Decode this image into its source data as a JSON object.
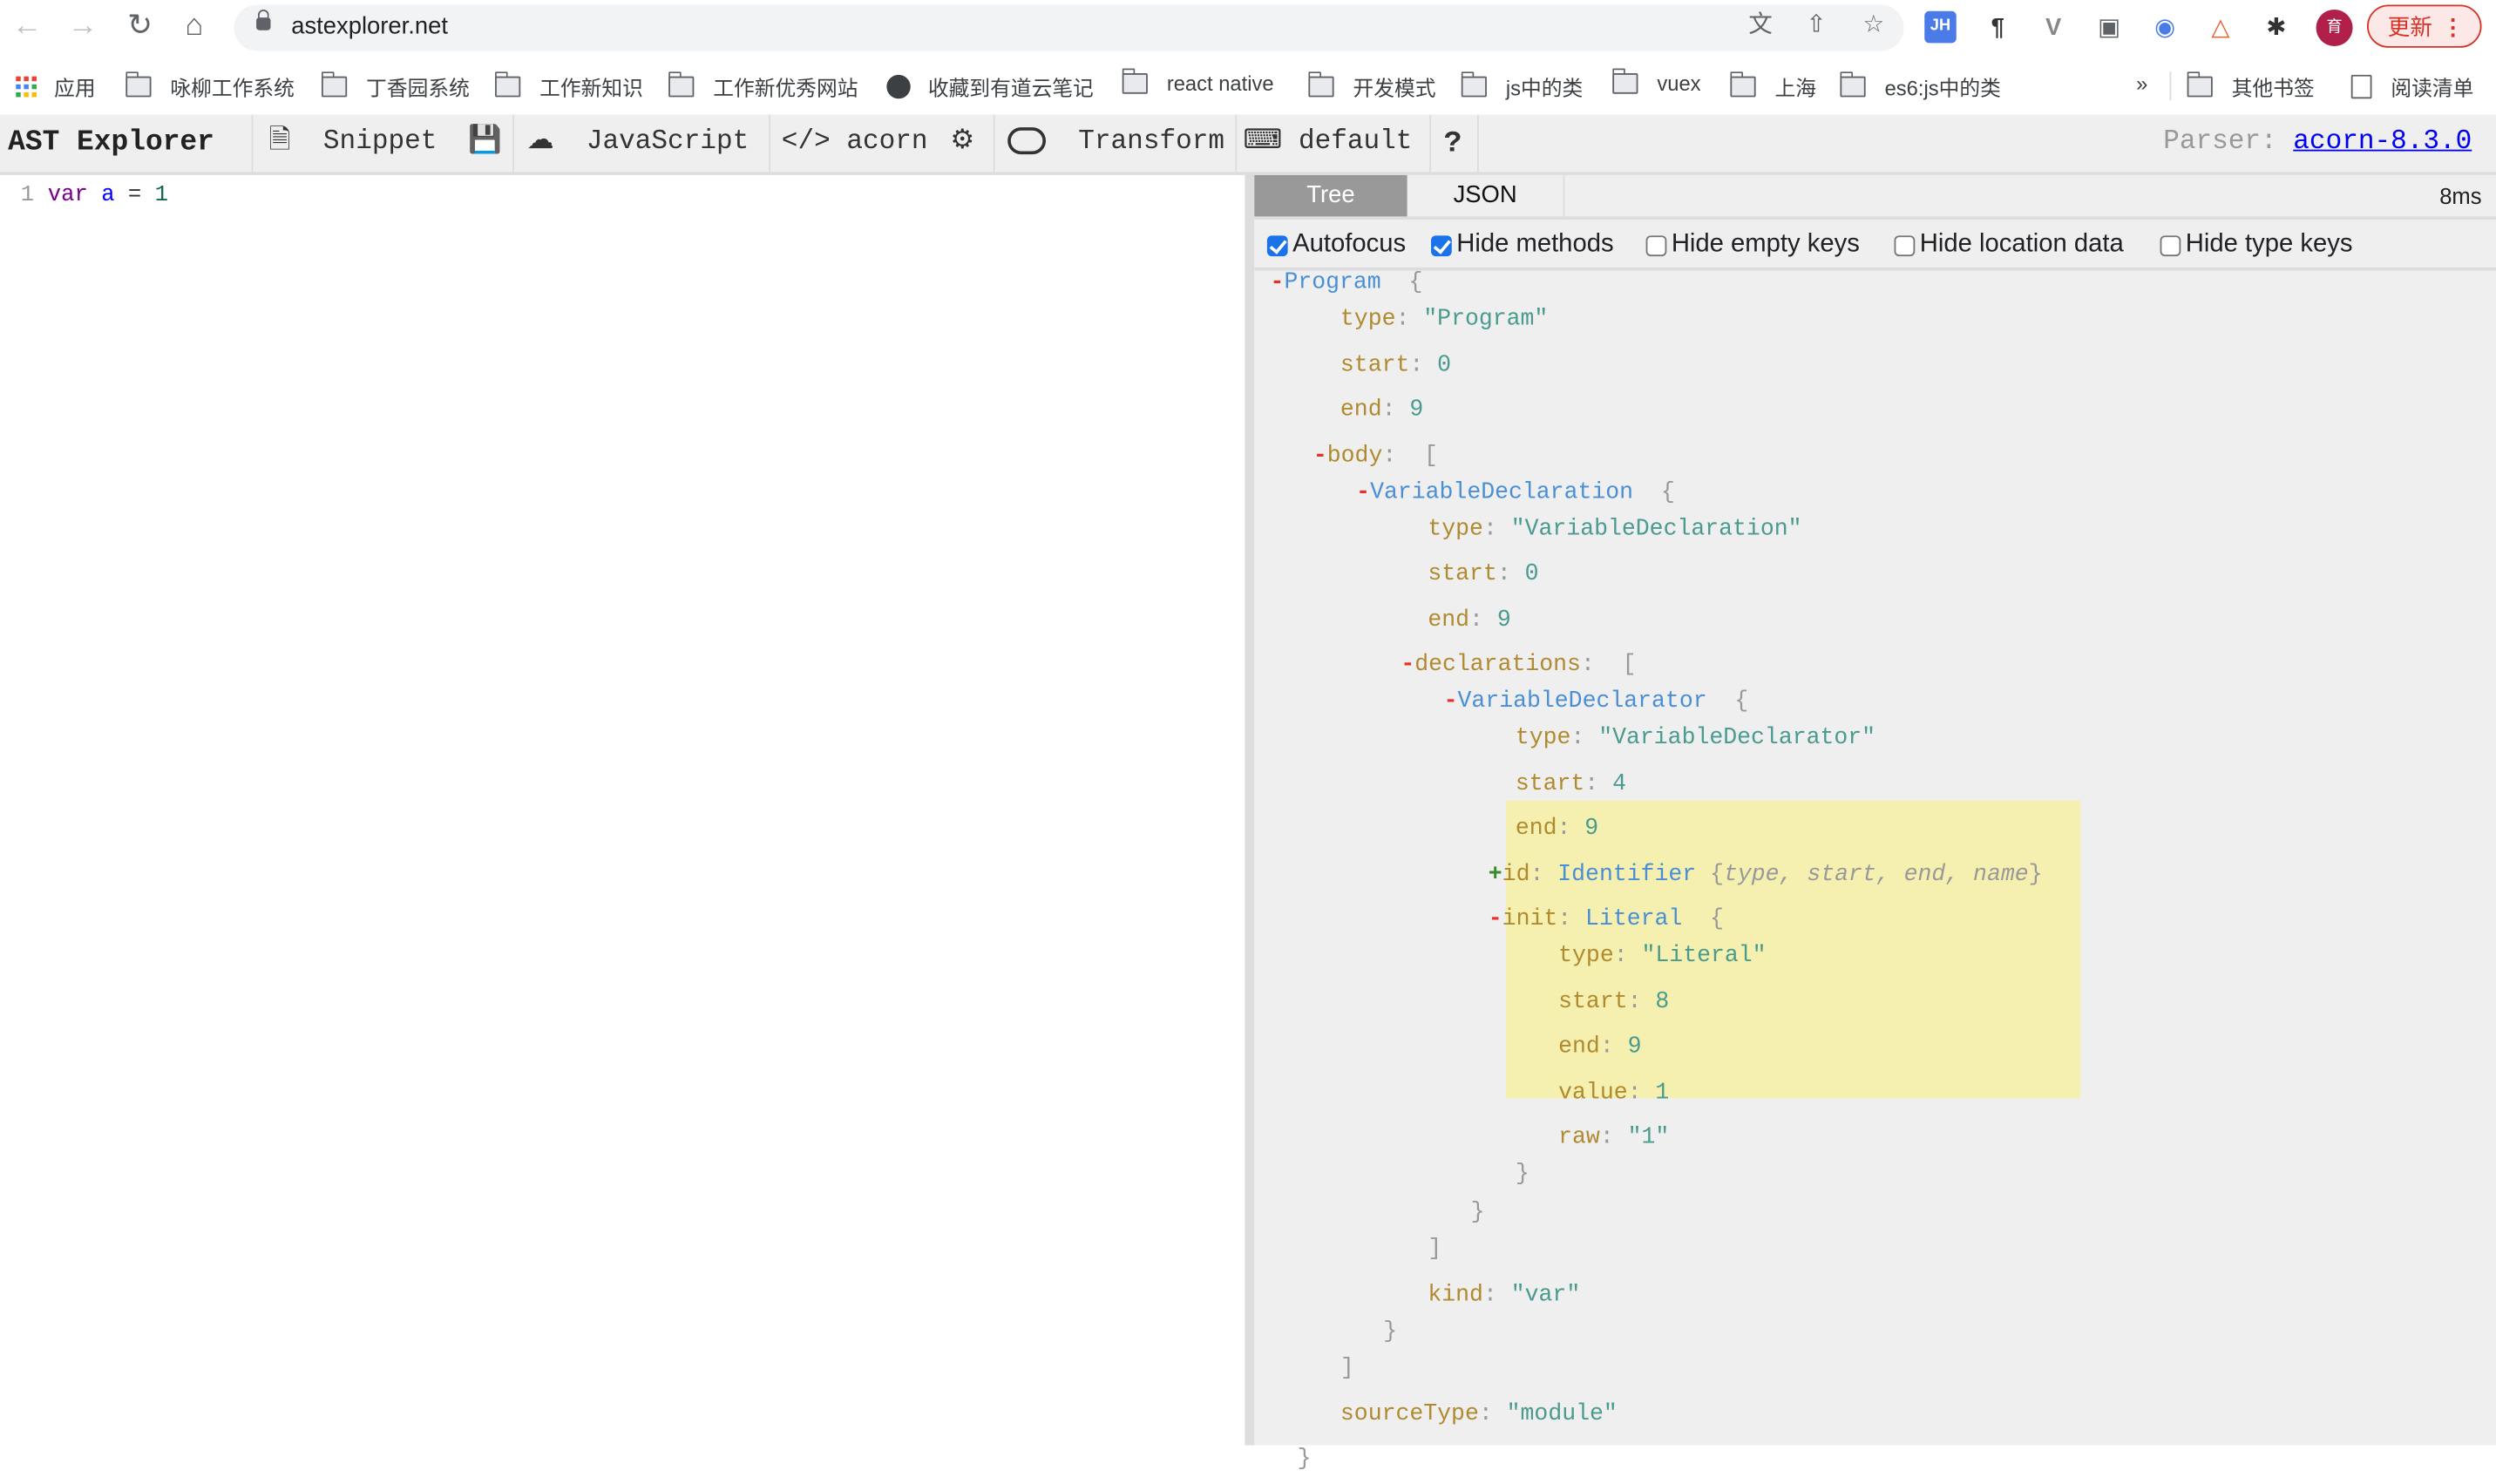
{
  "browser": {
    "url": "astexplorer.net",
    "update_label": "更新",
    "profile_initial": "育",
    "extensions": [
      "translate-icon",
      "share-icon",
      "star-icon",
      "jh-extension-icon",
      "pilcrow-extension-icon",
      "vue-devtools-icon",
      "extension-icon",
      "extension-icon",
      "extension-icon",
      "puzzle-icon"
    ]
  },
  "bookmarks": {
    "apps": "应用",
    "items": [
      "咏柳工作系统",
      "丁香园系统",
      "工作新知识",
      "工作新优秀网站",
      "收藏到有道云笔记",
      "react native",
      "开发模式",
      "js中的类",
      "vuex",
      "上海",
      "es6:js中的类"
    ],
    "more": "»",
    "other": "其他书签",
    "reading_list": "阅读清单"
  },
  "toolbar": {
    "brand": "AST Explorer",
    "snippet": "Snippet",
    "language": "JavaScript",
    "parser": "acorn",
    "transform": "Transform",
    "keymap": "default",
    "help": "?",
    "parser_label": "Parser:",
    "parser_version": "acorn-8.3.0"
  },
  "editor": {
    "line_number": "1",
    "code": {
      "kw": "var",
      "name": "a",
      "op": "=",
      "num": "1"
    }
  },
  "panel": {
    "tabs": [
      "Tree",
      "JSON"
    ],
    "active_tab": "Tree",
    "time": "8ms",
    "options": [
      {
        "label": "Autofocus",
        "checked": true
      },
      {
        "label": "Hide methods",
        "checked": true
      },
      {
        "label": "Hide empty keys",
        "checked": false
      },
      {
        "label": "Hide location data",
        "checked": false
      },
      {
        "label": "Hide type keys",
        "checked": false
      }
    ]
  },
  "tree": {
    "program": "Program",
    "program_type": "\"Program\"",
    "program_start": "0",
    "program_end": "9",
    "vd": "VariableDeclaration",
    "vd_type": "\"VariableDeclaration\"",
    "vd_start": "0",
    "vd_end": "9",
    "vdr": "VariableDeclarator",
    "vdr_type": "\"VariableDeclarator\"",
    "vdr_start": "4",
    "vdr_end": "9",
    "id_node": "Identifier",
    "id_summary": "type, start, end, name",
    "init_node": "Literal",
    "lit_type": "\"Literal\"",
    "lit_start": "8",
    "lit_end": "9",
    "lit_value": "1",
    "lit_raw": "\"1\"",
    "kind": "\"var\"",
    "source_type": "\"module\"",
    "keys": {
      "type": "type",
      "start": "start",
      "end": "end",
      "body": "body",
      "declarations": "declarations",
      "id": "id",
      "init": "init",
      "value": "value",
      "raw": "raw",
      "kind": "kind",
      "sourceType": "sourceType"
    }
  },
  "colors": {
    "key": "#b08a2f",
    "value": "#4a9b8f",
    "node": "#4a8fd6",
    "collapse": "#e8302a",
    "expand": "#3a8a2a",
    "highlight": "#f5efb0",
    "active_tab": "#999999"
  }
}
